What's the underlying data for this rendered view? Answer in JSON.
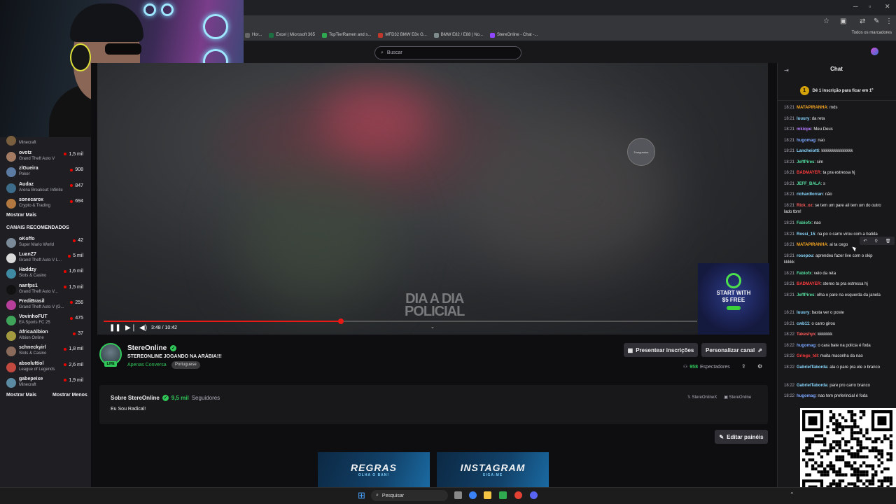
{
  "browser": {
    "bookmarks": [
      {
        "label": "Hor...",
        "color": "#666666"
      },
      {
        "label": "Excel | Microsoft 365",
        "color": "#1d6f42"
      },
      {
        "label": "TopTierRamen and s...",
        "color": "#2fa84f"
      },
      {
        "label": "MFD32 BMW E8x G...",
        "color": "#c0392b"
      },
      {
        "label": "BMW E82 / E88 | No...",
        "color": "#7f8c8d"
      },
      {
        "label": "StereOnline - Chat -...",
        "color": "#9147ff"
      }
    ],
    "all_bookmarks": "Todos os marcadores"
  },
  "search": {
    "placeholder": "Buscar"
  },
  "sidebar": {
    "followed": [
      {
        "name": "",
        "game": "Minecraft",
        "viewers": "",
        "color": "#7a5f3f"
      },
      {
        "name": "ovotz",
        "game": "Grand Theft Auto V",
        "viewers": "1,5 mil",
        "color": "#a37b63"
      },
      {
        "name": "zlGueira",
        "game": "Poker",
        "viewers": "908",
        "color": "#5b7ba3"
      },
      {
        "name": "Audaz",
        "game": "Arena Breakout: Infinite",
        "viewers": "847",
        "color": "#3d6b8a"
      },
      {
        "name": "sonecarox",
        "game": "Crypto & Trading",
        "viewers": "694",
        "color": "#b3783f"
      }
    ],
    "show_more": "Mostrar Mais",
    "recommended_title": "CANAIS RECOMENDADOS",
    "recommended": [
      {
        "name": "oKoffo",
        "game": "Super Mario World",
        "viewers": "42",
        "color": "#7b8a99"
      },
      {
        "name": "LuanZ7",
        "game": "Grand Theft Auto V L...",
        "viewers": "5 mil",
        "color": "#d9d9d9"
      },
      {
        "name": "Haddzy",
        "game": "Slots & Casino",
        "viewers": "1,6 mil",
        "color": "#3f8aa3"
      },
      {
        "name": "nanfps1",
        "game": "Grand Theft Auto V...",
        "viewers": "1,5 mil",
        "color": "#111111"
      },
      {
        "name": "FrediBrasil",
        "game": "Grand Theft Auto V (G...",
        "viewers": "256",
        "color": "#b53f9a"
      },
      {
        "name": "VovinhoFUT",
        "game": "EA Sports FC 25",
        "viewers": "475",
        "color": "#3fa35a"
      },
      {
        "name": "AfricaAlbion",
        "game": "Albion Online",
        "viewers": "37",
        "color": "#a39a3f"
      },
      {
        "name": "schneckyirl",
        "game": "Slots & Casino",
        "viewers": "1,8 mil",
        "color": "#8a6b5b"
      },
      {
        "name": "absoluttiol",
        "game": "League of Legends",
        "viewers": "2,6 mil",
        "color": "#c2493f"
      },
      {
        "name": "gabepeixe",
        "game": "Minecraft",
        "viewers": "1,9 mil",
        "color": "#5b8aa3"
      }
    ],
    "show_more_2": "Mostrar Mais",
    "show_less": "Mostrar Menos"
  },
  "video": {
    "time": "3:48 / 10:42",
    "progress": 0.4,
    "countdown": "5 segundos",
    "watermark_line1": "DIA A DIA",
    "watermark_line2": "POLICIAL",
    "ad_line1": "START WITH",
    "ad_line2": "$5 FREE"
  },
  "channel": {
    "name": "StereOnline",
    "title": "STEREONLINE JOGANDO NA ARÁBIA!!!",
    "category": "Apenas Conversa",
    "language": "Portuguese",
    "live_tag": "LIVE",
    "gift_button": "Presentear inscrições",
    "customize_button": "Personalizar canal",
    "viewer_count": "958",
    "viewer_label": "Espectadores"
  },
  "about": {
    "title": "Sobre StereOnline",
    "followers_count": "9,5 mil",
    "followers_label": "Seguidores",
    "description": "Eu Sou Radical!",
    "link_x": "StereOnlineX",
    "link_2": "StereOnline",
    "edit_panels": "Editar painéis"
  },
  "panels": [
    {
      "big": "REGRAS",
      "small": "OLHA O BAN!"
    },
    {
      "big": "INSTAGRAM",
      "small": "SIGA-ME"
    }
  ],
  "chat": {
    "title": "Chat",
    "promo": "Dê 1 inscrição para ficar em 1º",
    "messages": [
      {
        "time": "18:21",
        "user": "MATAPIRANHA",
        "text": "mds",
        "color": "#f5a623"
      },
      {
        "time": "18:21",
        "user": "luuury",
        "text": "da reta",
        "color": "#8ad9ff"
      },
      {
        "time": "18:21",
        "user": "mkiope",
        "text": "Meu Deus",
        "color": "#b57bff"
      },
      {
        "time": "18:21",
        "user": "hugomag",
        "text": "nao",
        "color": "#7aa6ff"
      },
      {
        "time": "18:21",
        "user": "Lancheiotti",
        "text": "kkkkkkkkkkkkkkk",
        "color": "#8ad9ff"
      },
      {
        "time": "18:21",
        "user": "JeffPires",
        "text": "sim",
        "color": "#55e0a0"
      },
      {
        "time": "18:21",
        "user": "BADMAYER",
        "text": "ta pra estressa hj",
        "color": "#ff3b3b"
      },
      {
        "time": "18:21",
        "user": "JEFF_BALA",
        "text": "s",
        "color": "#55e0a0"
      },
      {
        "time": "18:21",
        "user": "richardlorran",
        "text": "não",
        "color": "#8ad9ff"
      },
      {
        "time": "18:21",
        "user": "Rick_oz",
        "text": "se tem um pare ali tem um do outro lado tbm!",
        "color": "#ff5b5b"
      },
      {
        "time": "18:21",
        "user": "Fabiofx",
        "text": "nao",
        "color": "#55e0a0"
      },
      {
        "time": "18:21",
        "user": "Rossi_15",
        "text": "na po o carro virou com a batida",
        "color": "#8ad9ff"
      },
      {
        "time": "18:21",
        "user": "MATAPIRANHA",
        "text": "ai ta cego",
        "color": "#f5a623"
      },
      {
        "time": "18:21",
        "user": "rosepou",
        "text": "aprendeu fazer live com o skip kkkkk",
        "color": "#8ad9ff"
      },
      {
        "time": "18:21",
        "user": "Fabiofx",
        "text": "veio da reta",
        "color": "#55e0a0"
      },
      {
        "time": "18:21",
        "user": "BADMAYER",
        "text": "stereo ta pra estressa hj",
        "color": "#ff3b3b"
      },
      {
        "time": "18:21",
        "user": "JeffPires",
        "text": "olha o pare na esquerda da janela",
        "color": "#55e0a0"
      },
      {
        "time": "18:21",
        "user": "luuury",
        "text": "basta ver o poste",
        "color": "#8ad9ff"
      },
      {
        "time": "18:21",
        "user": "cwb11",
        "text": "o carro girou",
        "color": "#8ad9ff"
      },
      {
        "time": "18:22",
        "user": "Takeshyx",
        "text": "kkkkkkk",
        "color": "#ff5b5b"
      },
      {
        "time": "18:22",
        "user": "hugomag",
        "text": "o cara bate na policia é foda",
        "color": "#7aa6ff"
      },
      {
        "time": "18:22",
        "user": "Gringo_tdl",
        "text": "muita maconha da nao",
        "color": "#ff3b3b"
      },
      {
        "time": "18:22",
        "user": "GabrielTaborda",
        "text": "ala o pare pra ele o branco",
        "color": "#8ad9ff"
      },
      {
        "time": "18:22",
        "user": "GabrielTaborda",
        "text": "pare pro carro branco",
        "color": "#8ad9ff"
      },
      {
        "time": "18:22",
        "user": "hugomag",
        "text": "nao tem preferincial é foda",
        "color": "#7aa6ff"
      }
    ]
  },
  "taskbar": {
    "search": "Pesquisar"
  }
}
